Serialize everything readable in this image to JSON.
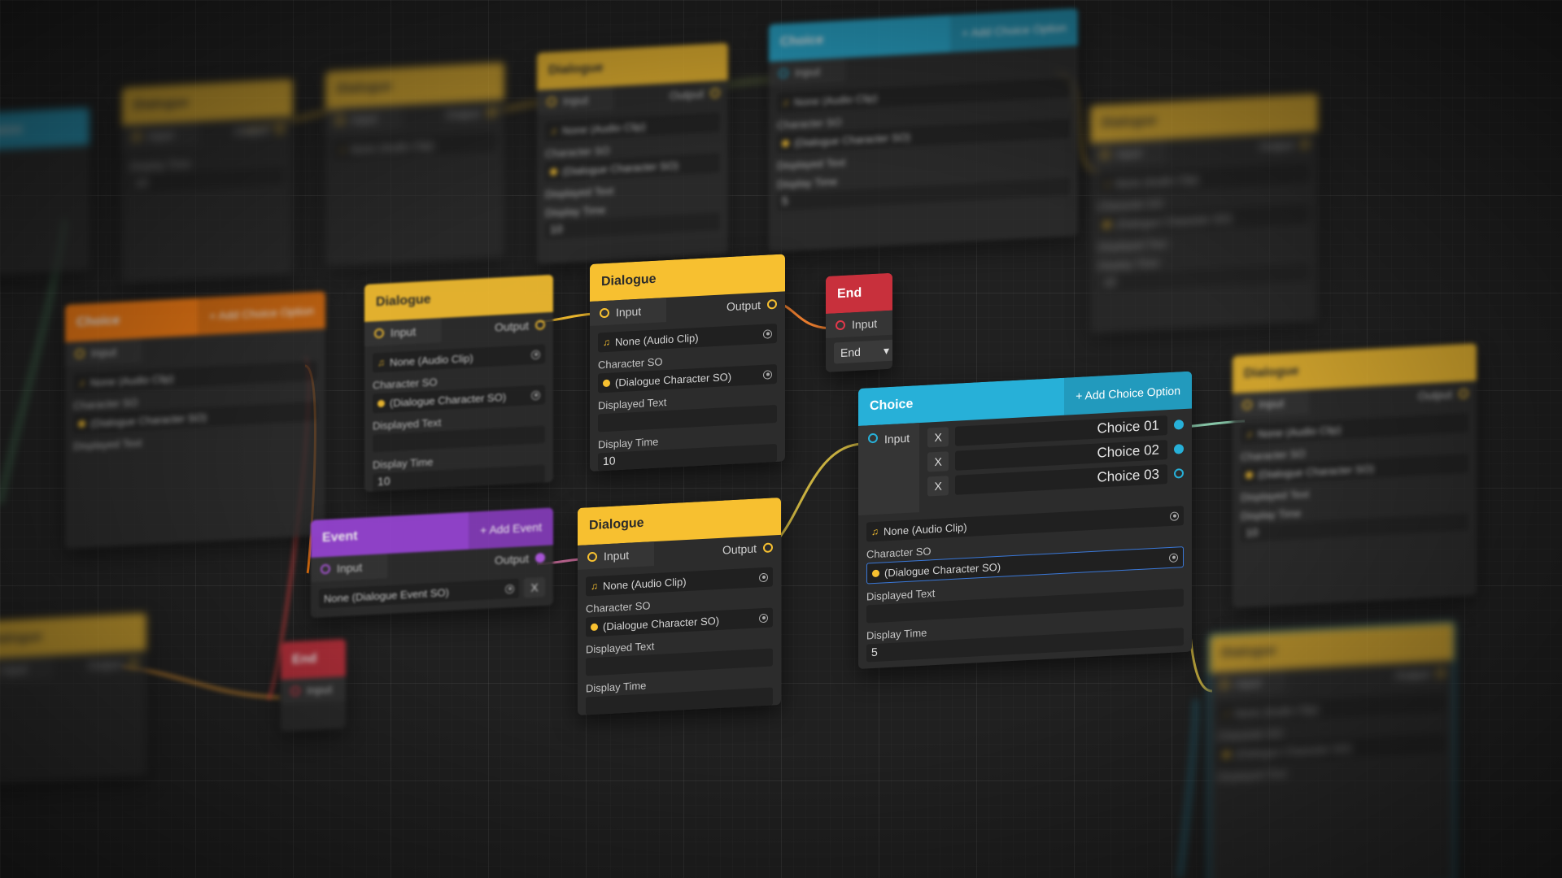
{
  "colors": {
    "dialogue": "#f7c030",
    "choice": "#27b0d8",
    "event": "#9a45d8",
    "end": "#c8303c",
    "timer": "#ff7f10",
    "background": "#202020"
  },
  "icons": {
    "audio": "music-note-icon",
    "character": "character-icon",
    "target": "object-picker-icon",
    "remove": "remove-x-icon",
    "dropdown": "chevron-down-icon"
  },
  "labels": {
    "dialogue": "Dialogue",
    "choice": "Choice",
    "event": "Event",
    "end": "End",
    "input": "Input",
    "output": "Output",
    "audio_none": "None (Audio Clip)",
    "character_so": "Character SO",
    "character_none": "(Dialogue Character SO)",
    "displayed_text": "Displayed Text",
    "display_time": "Display Time",
    "add_choice": "+ Add Choice Option",
    "add_event": "+ Add Event",
    "event_none": "None (Dialogue Event SO)",
    "remove": "X",
    "end_option": "End"
  },
  "nodes": {
    "dialogue_a": {
      "display_time": "10"
    },
    "dialogue_b": {
      "display_time": "10"
    },
    "dialogue_c": {
      "display_time": ""
    },
    "choice": {
      "display_time": "5",
      "options": [
        "Choice 01",
        "Choice 02",
        "Choice 03"
      ]
    },
    "bg_top_1": {
      "display_time": "10"
    },
    "bg_top_2": {
      "display_time": "5"
    },
    "bg_right_1": {
      "display_time": "10"
    },
    "bg_right_2": {
      "display_time": "10"
    }
  }
}
